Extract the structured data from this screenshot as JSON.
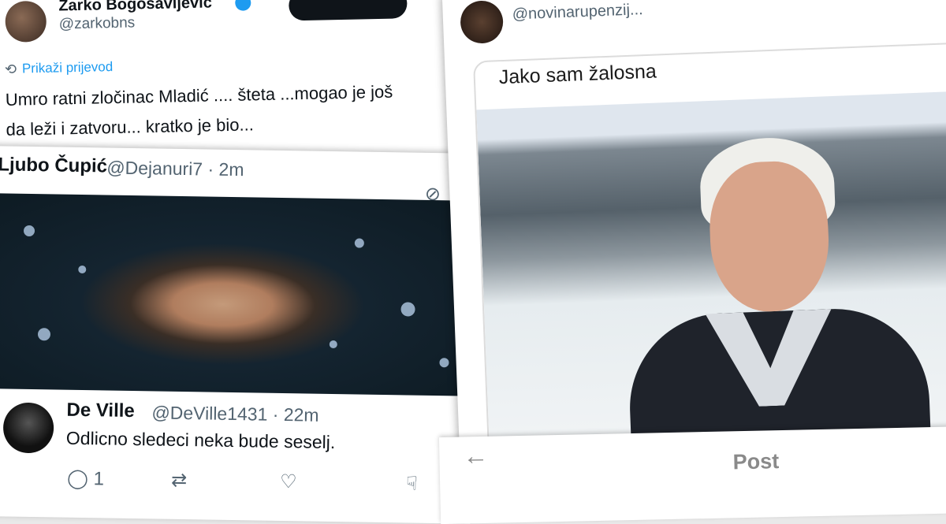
{
  "tweet_top": {
    "name": "Žarko Bogosavljević",
    "handle": "@zarkobns",
    "translate_label": "Prikaži prijevod",
    "text_line1": "Umro ratni zločinac Mladić .... šteta ...mogao je još",
    "text_line2": "da leži i zatvoru... kratko je bio..."
  },
  "reply_card": {
    "name": "Ljubo Čupić",
    "handle_time": "@Dejanuri7 · 2m",
    "reply_name": "De Ville",
    "reply_handle_time": "@DeVille1431 · 22m",
    "reply_text": "Odlicno sledeci neka bude seselj.",
    "reply_count": "1"
  },
  "right_card": {
    "handle": "@novinarupenzij...",
    "image_caption": "Jako sam žalosna"
  },
  "post_header": {
    "back_icon": "←",
    "title": "Post"
  },
  "icons": {
    "translate": "translate-icon",
    "reply": "reply-icon",
    "retweet": "retweet-icon",
    "like": "like-icon",
    "dislike": "dislike-icon"
  },
  "colors": {
    "link": "#1d9bf0",
    "muted": "#536471",
    "text": "#0f1419"
  }
}
